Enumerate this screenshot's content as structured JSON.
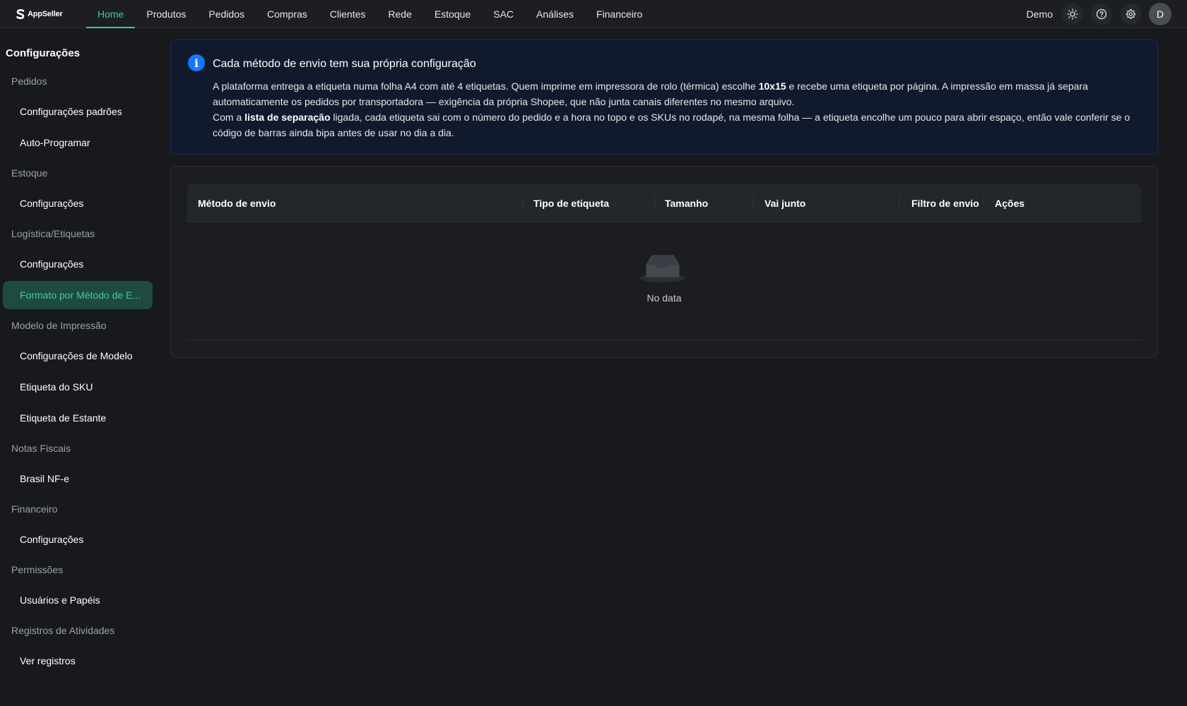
{
  "brand": {
    "name": "AppSeller"
  },
  "nav": {
    "items": [
      {
        "label": "Home",
        "active": true
      },
      {
        "label": "Produtos"
      },
      {
        "label": "Pedidos"
      },
      {
        "label": "Compras"
      },
      {
        "label": "Clientes"
      },
      {
        "label": "Rede"
      },
      {
        "label": "Estoque"
      },
      {
        "label": "SAC"
      },
      {
        "label": "Análises"
      },
      {
        "label": "Financeiro"
      }
    ]
  },
  "header": {
    "user_name": "Demo",
    "avatar_initial": "D",
    "icons": [
      "sun-icon",
      "help-icon",
      "gear-icon"
    ]
  },
  "sidebar": {
    "title": "Configurações",
    "groups": [
      {
        "label": "Pedidos",
        "items": [
          "Configurações padrões",
          "Auto-Programar"
        ]
      },
      {
        "label": "Estoque",
        "items": [
          "Configurações"
        ]
      },
      {
        "label": "Logística/Etiquetas",
        "items": [
          "Configurações",
          "Formato por Método de E..."
        ]
      },
      {
        "label": "Modelo de Impressão",
        "items": [
          "Configurações de Modelo",
          "Etiqueta do SKU",
          "Etiqueta de Estante"
        ]
      },
      {
        "label": "Notas Fiscais",
        "items": [
          "Brasil NF-e"
        ]
      },
      {
        "label": "Financeiro",
        "items": [
          "Configurações"
        ]
      },
      {
        "label": "Permissões",
        "items": [
          "Usuários e Papéis"
        ]
      },
      {
        "label": "Registros de Atividades",
        "items": [
          "Ver registros"
        ]
      }
    ],
    "active_item": "Formato por Método de E..."
  },
  "alert": {
    "title": "Cada método de envio tem sua própria configuração",
    "p1_a": "A plataforma entrega a etiqueta numa folha A4 com até 4 etiquetas. Quem imprime em impressora de rolo (térmica) escolhe ",
    "p1_bold": "10x15",
    "p1_b": " e recebe uma etiqueta por página. A impressão em massa já separa automaticamente os pedidos por transportadora — exigência da própria Shopee, que não junta canais diferentes no mesmo arquivo.",
    "p2_a": "Com a ",
    "p2_bold": "lista de separação",
    "p2_b": " ligada, cada etiqueta sai com o número do pedido e a hora no topo e os SKUs no rodapé, na mesma folha — a etiqueta encolhe um pouco para abrir espaço, então vale conferir se o código de barras ainda bipa antes de usar no dia a dia."
  },
  "table": {
    "columns": [
      "Método de envio",
      "Tipo de etiqueta",
      "Tamanho",
      "Vai junto",
      "Filtro de envio",
      "Ações"
    ],
    "rows": [],
    "empty_text": "No data"
  },
  "colors": {
    "accent": "#3ec9a0",
    "info": "#1677ff",
    "background": "#17191d"
  }
}
